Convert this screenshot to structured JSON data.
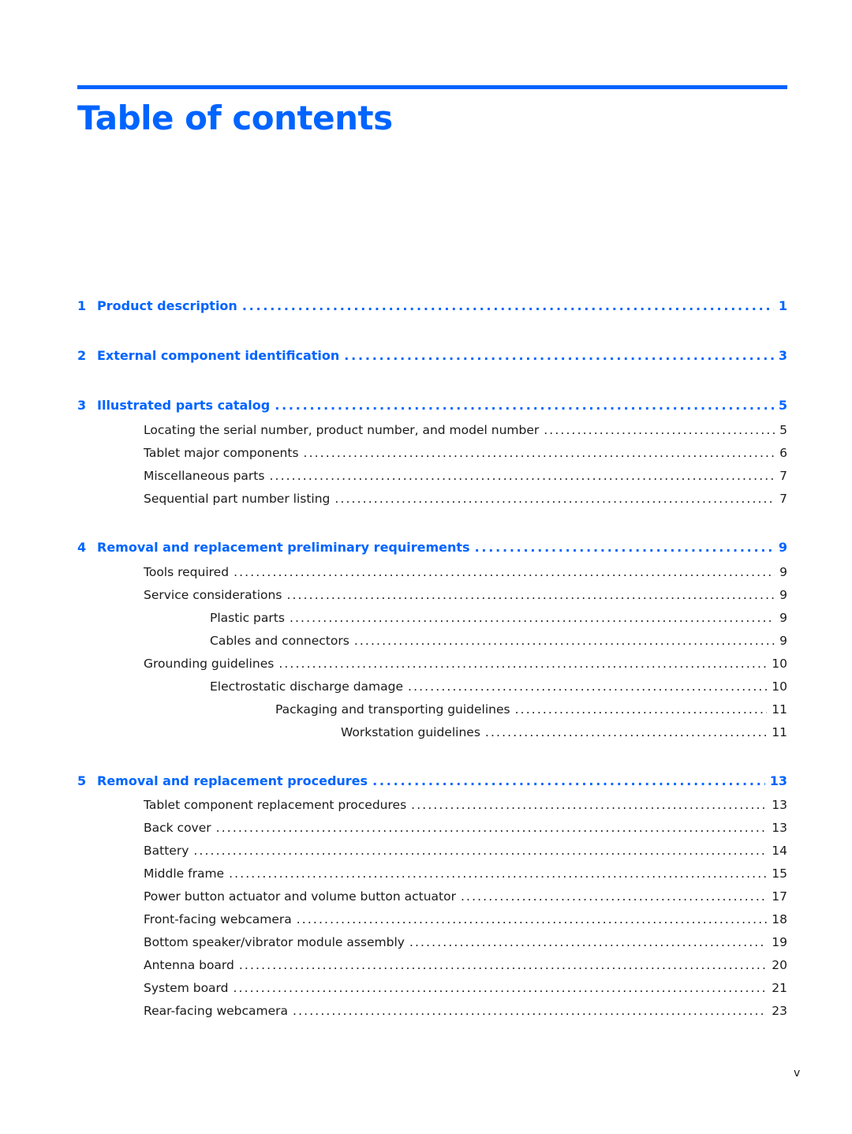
{
  "header": {
    "title": "Table of contents"
  },
  "colors": {
    "accent": "#0064ff",
    "text": "#1a1a1a"
  },
  "toc": [
    {
      "type": "chapter",
      "number": "1",
      "label": "Product description",
      "page": "1"
    },
    {
      "type": "chapter",
      "number": "2",
      "label": "External component identification",
      "page": "3"
    },
    {
      "type": "chapter",
      "number": "3",
      "label": "Illustrated parts catalog",
      "page": "5"
    },
    {
      "type": "section",
      "level": 1,
      "label": "Locating the serial number, product number, and model number",
      "page": "5"
    },
    {
      "type": "section",
      "level": 1,
      "label": "Tablet major components",
      "page": "6"
    },
    {
      "type": "section",
      "level": 1,
      "label": "Miscellaneous parts",
      "page": "7"
    },
    {
      "type": "section",
      "level": 1,
      "label": "Sequential part number listing",
      "page": "7"
    },
    {
      "type": "chapter",
      "number": "4",
      "label": "Removal and replacement preliminary requirements",
      "page": "9"
    },
    {
      "type": "section",
      "level": 1,
      "label": "Tools required",
      "page": "9"
    },
    {
      "type": "section",
      "level": 1,
      "label": "Service considerations",
      "page": "9"
    },
    {
      "type": "section",
      "level": 2,
      "label": "Plastic parts",
      "page": "9"
    },
    {
      "type": "section",
      "level": 2,
      "label": "Cables and connectors",
      "page": "9"
    },
    {
      "type": "section",
      "level": 1,
      "label": "Grounding guidelines",
      "page": "10"
    },
    {
      "type": "section",
      "level": 2,
      "label": "Electrostatic discharge damage",
      "page": "10"
    },
    {
      "type": "section",
      "level": 3,
      "label": "Packaging and transporting guidelines",
      "page": "11"
    },
    {
      "type": "section",
      "level": 4,
      "label": "Workstation guidelines",
      "page": "11"
    },
    {
      "type": "chapter",
      "number": "5",
      "label": "Removal and replacement procedures",
      "page": "13"
    },
    {
      "type": "section",
      "level": 1,
      "label": "Tablet component replacement procedures",
      "page": "13"
    },
    {
      "type": "section",
      "level": 1,
      "label": "Back cover",
      "page": "13"
    },
    {
      "type": "section",
      "level": 1,
      "label": "Battery",
      "page": "14"
    },
    {
      "type": "section",
      "level": 1,
      "label": "Middle frame",
      "page": "15"
    },
    {
      "type": "section",
      "level": 1,
      "label": "Power button actuator and volume button actuator",
      "page": "17"
    },
    {
      "type": "section",
      "level": 1,
      "label": "Front-facing webcamera",
      "page": "18"
    },
    {
      "type": "section",
      "level": 1,
      "label": "Bottom speaker/vibrator module assembly",
      "page": "19"
    },
    {
      "type": "section",
      "level": 1,
      "label": "Antenna board",
      "page": "20"
    },
    {
      "type": "section",
      "level": 1,
      "label": "System board",
      "page": "21"
    },
    {
      "type": "section",
      "level": 1,
      "label": "Rear-facing webcamera",
      "page": "23"
    }
  ],
  "footer": {
    "page_number": "v"
  }
}
